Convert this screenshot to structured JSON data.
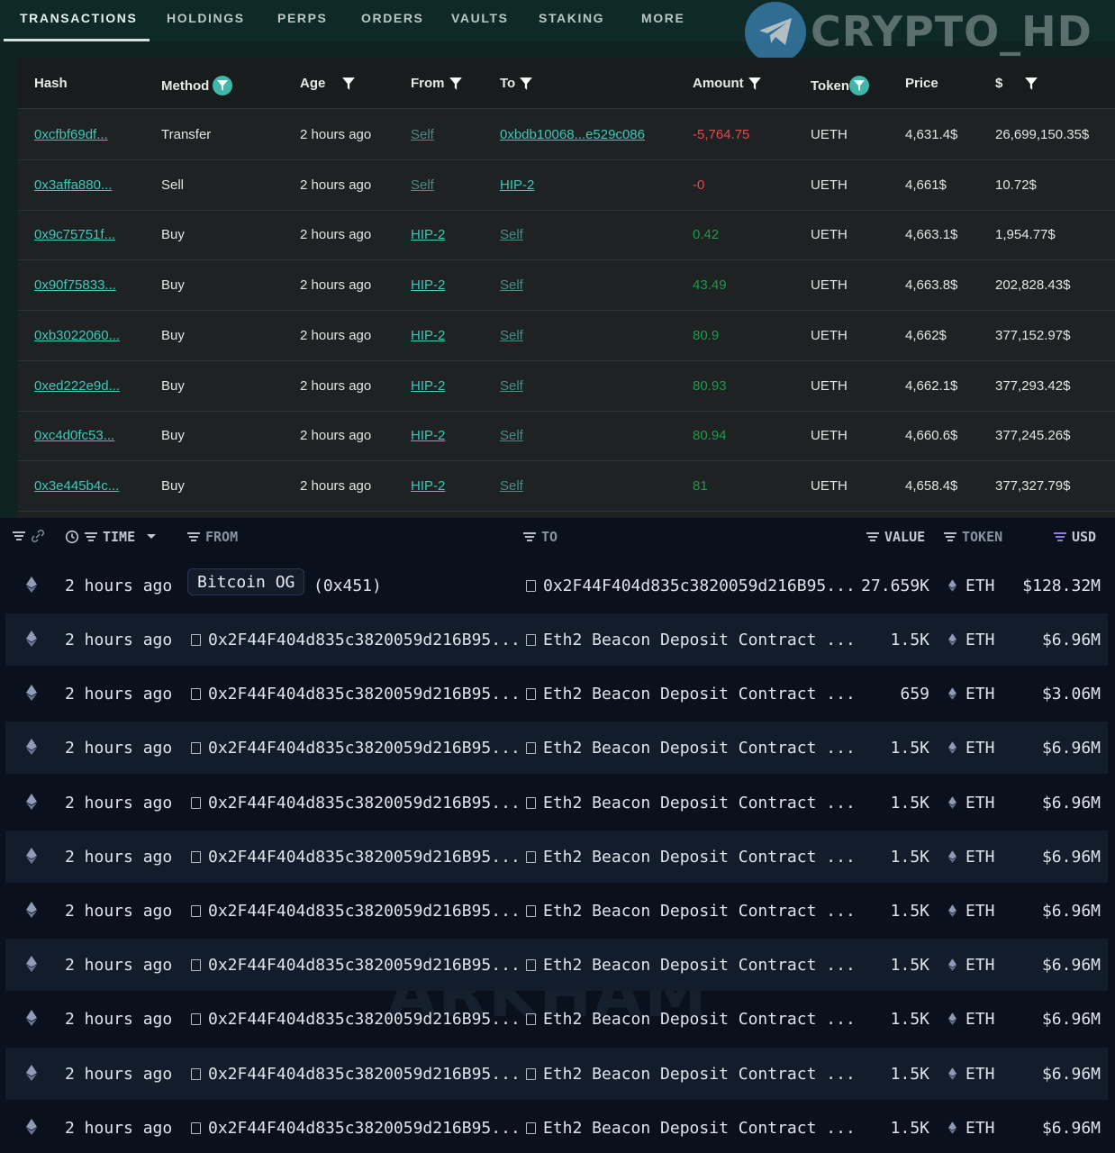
{
  "tabs": [
    "TRANSACTIONS",
    "HOLDINGS",
    "PERPS",
    "ORDERS",
    "VAULTS",
    "STAKING",
    "MORE"
  ],
  "watermark": "CRYPTO_HD",
  "bottom_watermark": "ARKHAM",
  "top_table": {
    "headers": [
      "Hash",
      "Method",
      "Age",
      "From",
      "To",
      "Amount",
      "Token",
      "Price",
      "$"
    ],
    "rows": [
      [
        "0xcfbf69df...",
        "Transfer",
        "2 hours ago",
        "Self",
        "0xbdb10068...e529c086",
        "-5,764.75",
        "UETH",
        "4,631.4$",
        "26,699,150.35$"
      ],
      [
        "0x3affa880...",
        "Sell",
        "2 hours ago",
        "Self",
        "HIP-2",
        "-0",
        "UETH",
        "4,661$",
        "10.72$"
      ],
      [
        "0x9c75751f...",
        "Buy",
        "2 hours ago",
        "HIP-2",
        "Self",
        "0.42",
        "UETH",
        "4,663.1$",
        "1,954.77$"
      ],
      [
        "0x90f75833...",
        "Buy",
        "2 hours ago",
        "HIP-2",
        "Self",
        "43.49",
        "UETH",
        "4,663.8$",
        "202,828.43$"
      ],
      [
        "0xb3022060...",
        "Buy",
        "2 hours ago",
        "HIP-2",
        "Self",
        "80.9",
        "UETH",
        "4,662$",
        "377,152.97$"
      ],
      [
        "0xed222e9d...",
        "Buy",
        "2 hours ago",
        "HIP-2",
        "Self",
        "80.93",
        "UETH",
        "4,662.1$",
        "377,293.42$"
      ],
      [
        "0xc4d0fc53...",
        "Buy",
        "2 hours ago",
        "HIP-2",
        "Self",
        "80.94",
        "UETH",
        "4,660.6$",
        "377,245.26$"
      ],
      [
        "0x3e445b4c...",
        "Buy",
        "2 hours ago",
        "HIP-2",
        "Self",
        "81",
        "UETH",
        "4,658.4$",
        "377,327.79$"
      ]
    ]
  },
  "bottom_table": {
    "headers": {
      "time": "TIME",
      "from": "FROM",
      "to": "TO",
      "value": "VALUE",
      "token": "TOKEN",
      "usd": "USD"
    },
    "first_row": {
      "time": "2 hours ago",
      "from_name": "Bitcoin OG",
      "from_addr": "(0x451)",
      "to": "0x2F44F404d835c3820059d216B95...",
      "value": "27.659K",
      "token": "ETH",
      "usd": "$128.32M"
    },
    "rows": [
      {
        "time": "2 hours ago",
        "from": "0x2F44F404d835c3820059d216B95...",
        "to": "Eth2 Beacon Deposit Contract ...",
        "value": "1.5K",
        "token": "ETH",
        "usd": "$6.96M"
      },
      {
        "time": "2 hours ago",
        "from": "0x2F44F404d835c3820059d216B95...",
        "to": "Eth2 Beacon Deposit Contract ...",
        "value": "659",
        "token": "ETH",
        "usd": "$3.06M"
      },
      {
        "time": "2 hours ago",
        "from": "0x2F44F404d835c3820059d216B95...",
        "to": "Eth2 Beacon Deposit Contract ...",
        "value": "1.5K",
        "token": "ETH",
        "usd": "$6.96M"
      },
      {
        "time": "2 hours ago",
        "from": "0x2F44F404d835c3820059d216B95...",
        "to": "Eth2 Beacon Deposit Contract ...",
        "value": "1.5K",
        "token": "ETH",
        "usd": "$6.96M"
      },
      {
        "time": "2 hours ago",
        "from": "0x2F44F404d835c3820059d216B95...",
        "to": "Eth2 Beacon Deposit Contract ...",
        "value": "1.5K",
        "token": "ETH",
        "usd": "$6.96M"
      },
      {
        "time": "2 hours ago",
        "from": "0x2F44F404d835c3820059d216B95...",
        "to": "Eth2 Beacon Deposit Contract ...",
        "value": "1.5K",
        "token": "ETH",
        "usd": "$6.96M"
      },
      {
        "time": "2 hours ago",
        "from": "0x2F44F404d835c3820059d216B95...",
        "to": "Eth2 Beacon Deposit Contract ...",
        "value": "1.5K",
        "token": "ETH",
        "usd": "$6.96M"
      },
      {
        "time": "2 hours ago",
        "from": "0x2F44F404d835c3820059d216B95...",
        "to": "Eth2 Beacon Deposit Contract ...",
        "value": "1.5K",
        "token": "ETH",
        "usd": "$6.96M"
      },
      {
        "time": "2 hours ago",
        "from": "0x2F44F404d835c3820059d216B95...",
        "to": "Eth2 Beacon Deposit Contract ...",
        "value": "1.5K",
        "token": "ETH",
        "usd": "$6.96M"
      },
      {
        "time": "2 hours ago",
        "from": "0x2F44F404d835c3820059d216B95...",
        "to": "Eth2 Beacon Deposit Contract ...",
        "value": "1.5K",
        "token": "ETH",
        "usd": "$6.96M"
      }
    ]
  }
}
